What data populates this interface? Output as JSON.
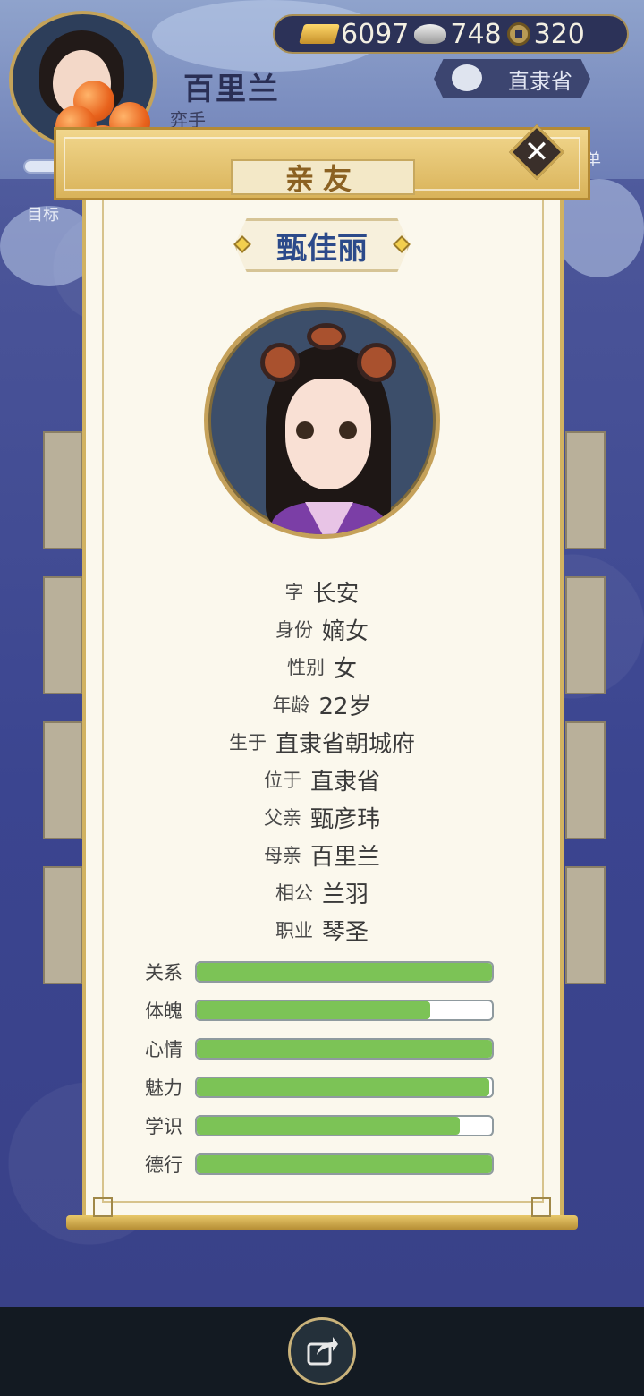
{
  "hud": {
    "player_name": "百里兰",
    "player_title": "弈手",
    "goal_label": "目标",
    "province": "直隶省",
    "menu_label": "菜单",
    "currency": {
      "gold": "6097",
      "silver": "748",
      "coin": "320"
    }
  },
  "panel": {
    "title": "亲友",
    "character_name": "甄佳丽",
    "info": [
      {
        "label": "字",
        "value": "长安"
      },
      {
        "label": "身份",
        "value": "嫡女"
      },
      {
        "label": "性别",
        "value": "女"
      },
      {
        "label": "年龄",
        "value": "22岁"
      },
      {
        "label": "生于",
        "value": "直隶省朝城府"
      },
      {
        "label": "位于",
        "value": "直隶省"
      },
      {
        "label": "父亲",
        "value": "甄彦玮"
      },
      {
        "label": "母亲",
        "value": "百里兰"
      },
      {
        "label": "相公",
        "value": "兰羽"
      },
      {
        "label": "职业",
        "value": "琴圣"
      }
    ],
    "stats": [
      {
        "label": "关系",
        "fraction": 1.0
      },
      {
        "label": "体魄",
        "fraction": 0.79
      },
      {
        "label": "心情",
        "fraction": 1.0
      },
      {
        "label": "魅力",
        "fraction": 0.99
      },
      {
        "label": "学识",
        "fraction": 0.89
      },
      {
        "label": "德行",
        "fraction": 1.0
      }
    ]
  },
  "colors": {
    "stat_fill": "#7cc356",
    "name_color": "#2c4a8a",
    "title_color": "#8b6122"
  },
  "icons": {
    "close": "close-icon",
    "share": "share-icon",
    "gold": "gold-ingot-icon",
    "silver": "silver-ingot-icon",
    "coin": "copper-coin-icon"
  }
}
